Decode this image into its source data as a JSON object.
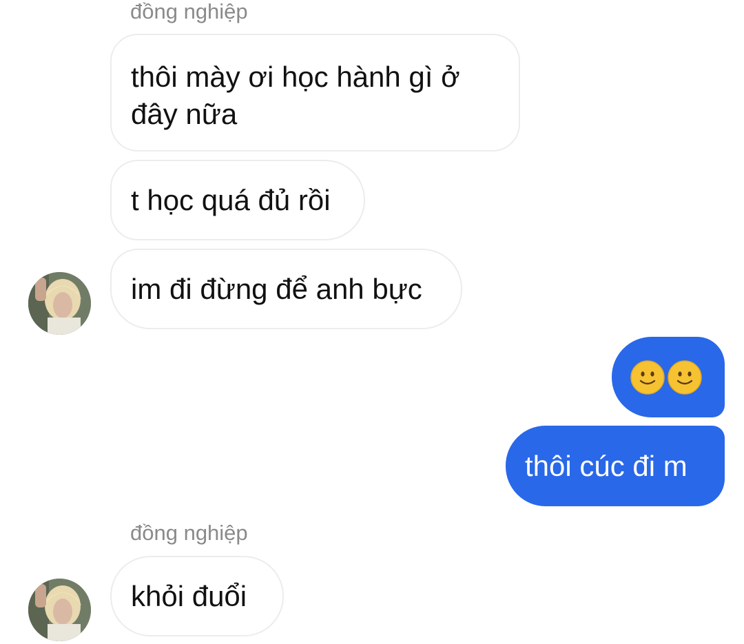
{
  "conversation": {
    "groups": [
      {
        "sender_name": "đồng nghiệp",
        "messages": [
          "thôi mày ơi học hành gì ở đây nữa",
          "t học quá đủ rồi",
          "im đi đừng để anh bực"
        ]
      },
      {
        "sender_name": "đồng nghiệp",
        "messages": [
          "khỏi đuổi"
        ]
      }
    ],
    "outgoing": [
      "🙂🙂",
      "thôi cúc đi m"
    ]
  },
  "colors": {
    "outgoing_bubble": "#2968e8",
    "incoming_border": "#ececec",
    "sender_name": "#8a8a8a"
  },
  "icons": {
    "avatar": "user-avatar-photo",
    "emoji": "slightly-smiling-face"
  }
}
